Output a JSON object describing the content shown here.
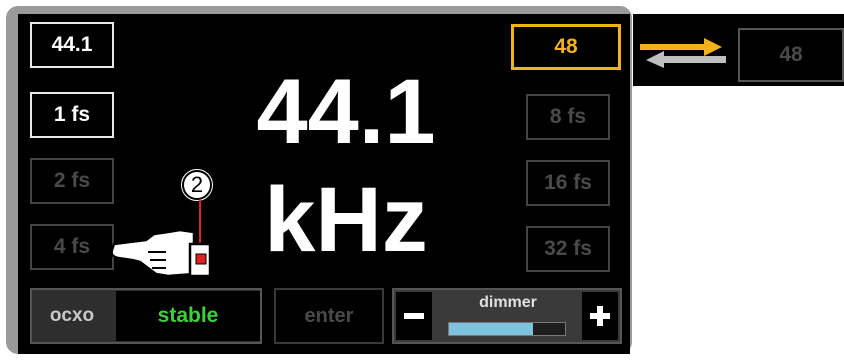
{
  "rates_left": [
    {
      "label": "44.1",
      "state": "active"
    },
    {
      "label": "1 fs",
      "state": "active"
    },
    {
      "label": "2 fs",
      "state": "dim"
    },
    {
      "label": "4 fs",
      "state": "dim"
    }
  ],
  "rates_right": [
    {
      "label": "48",
      "state": "selected"
    },
    {
      "label": "8 fs",
      "state": "dim"
    },
    {
      "label": "16 fs",
      "state": "dim"
    },
    {
      "label": "32 fs",
      "state": "dim"
    }
  ],
  "display": {
    "frequency": "44.1",
    "unit": "kHz"
  },
  "callout": {
    "number": "2"
  },
  "clock": {
    "label": "ocxo",
    "status": "stable"
  },
  "enter_label": "enter",
  "dimmer": {
    "label": "dimmer",
    "minus": "−",
    "plus": "+",
    "level": 0.72
  },
  "external": {
    "label": "48"
  },
  "colors": {
    "accent": "#f3b21a",
    "ok": "#3bd13b",
    "active": "#e9e9e9",
    "dim": "#4a4a4a",
    "dimmer_fill": "#7ec4de"
  }
}
